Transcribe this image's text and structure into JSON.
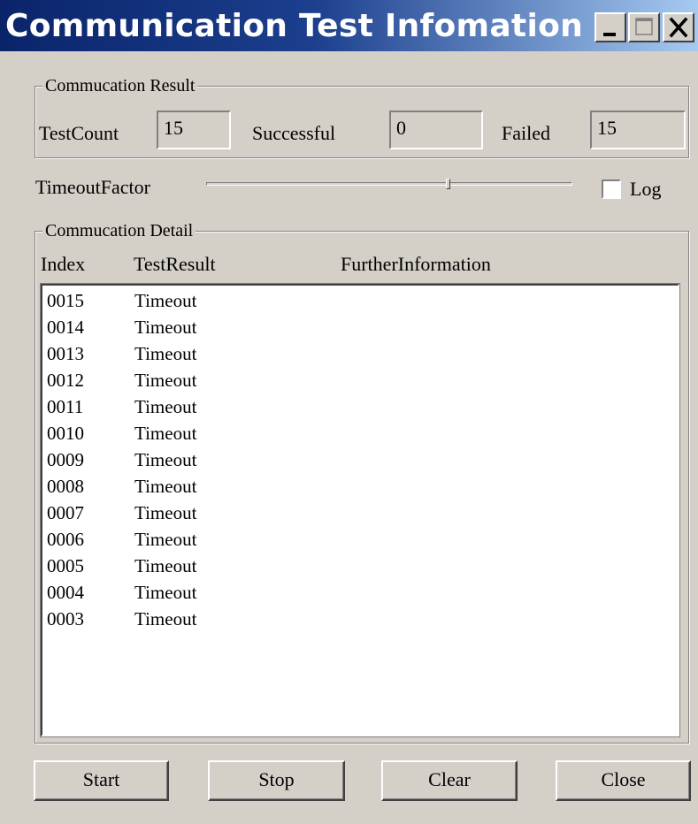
{
  "window": {
    "title": "Communication Test Infomation",
    "minimize_icon": "minimize-icon",
    "maximize_icon": "maximize-icon",
    "close_icon": "close-icon"
  },
  "result_group": {
    "label": "Commucation Result",
    "test_count_label": "TestCount",
    "test_count_value": "15",
    "successful_label": "Successful",
    "successful_value": "0",
    "failed_label": "Failed",
    "failed_value": "15"
  },
  "timeout": {
    "label": "TimeoutFactor",
    "slider_level": 0.66
  },
  "log": {
    "label": "Log",
    "checked": false
  },
  "detail_group": {
    "label": "Commucation Detail",
    "columns": [
      "Index",
      "TestResult",
      "FurtherInformation"
    ],
    "rows": [
      {
        "index": "0015",
        "result": "Timeout",
        "info": ""
      },
      {
        "index": "0014",
        "result": "Timeout",
        "info": ""
      },
      {
        "index": "0013",
        "result": "Timeout",
        "info": ""
      },
      {
        "index": "0012",
        "result": "Timeout",
        "info": ""
      },
      {
        "index": "0011",
        "result": "Timeout",
        "info": ""
      },
      {
        "index": "0010",
        "result": "Timeout",
        "info": ""
      },
      {
        "index": "0009",
        "result": "Timeout",
        "info": ""
      },
      {
        "index": "0008",
        "result": "Timeout",
        "info": ""
      },
      {
        "index": "0007",
        "result": "Timeout",
        "info": ""
      },
      {
        "index": "0006",
        "result": "Timeout",
        "info": ""
      },
      {
        "index": "0005",
        "result": "Timeout",
        "info": ""
      },
      {
        "index": "0004",
        "result": "Timeout",
        "info": ""
      },
      {
        "index": "0003",
        "result": "Timeout",
        "info": ""
      }
    ]
  },
  "buttons": {
    "start": "Start",
    "stop": "Stop",
    "clear": "Clear",
    "close": "Close"
  },
  "colors": {
    "title_bar_start": "#0a246a",
    "title_bar_end": "#a6caf0",
    "face": "#d4d0c8"
  }
}
